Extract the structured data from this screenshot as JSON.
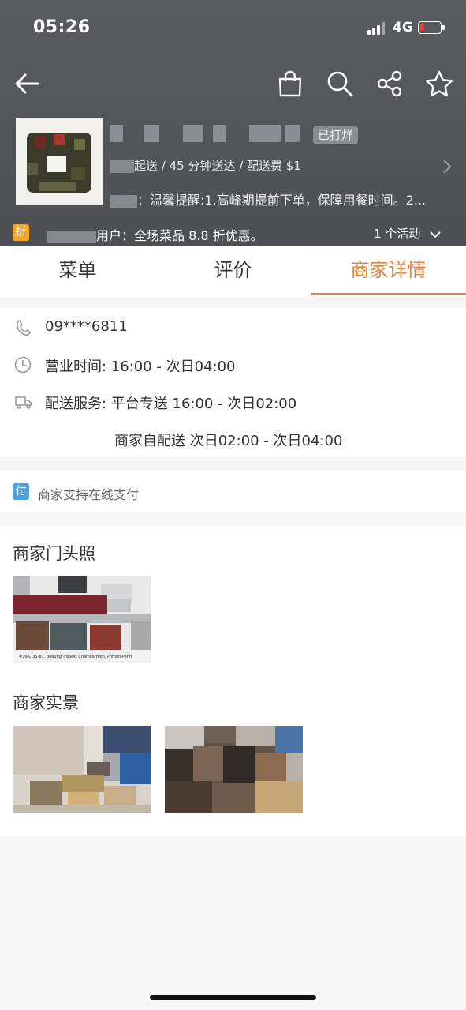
{
  "status_bar": {
    "time": "05:26",
    "network": "4G"
  },
  "shop": {
    "tag": "已打烊",
    "delivery_info": "起送 / 45 分钟送达 / 配送费 $1",
    "notice": "：温馨提醒:1.高峰期提前下单，保障用餐时间。2...",
    "promo": "用户：全场菜品 8.8 折优惠。",
    "discount_badge": "折",
    "activity_count": "1 个活动"
  },
  "nav": {
    "icons": [
      "back-arrow-icon",
      "shopping-bag-icon",
      "search-icon",
      "share-icon",
      "star-icon"
    ]
  },
  "tabs": [
    {
      "label": "菜单",
      "active": false
    },
    {
      "label": "评价",
      "active": false
    },
    {
      "label": "商家详情",
      "active": true
    }
  ],
  "details": {
    "phone": "09****6811",
    "hours": "营业时间: 16:00 - 次日04:00",
    "delivery_service": "配送服务: 平台专送 16:00 - 次日02:00",
    "merchant_delivery": "商家自配送 次日02:00 - 次日04:00"
  },
  "payment": {
    "badge": "付",
    "text": "商家支持在线支付"
  },
  "sections": {
    "storefront_title": "商家门头照",
    "interior_title": "商家实景",
    "storefront_caption": "#26A, 31-81, Boeung Trabek, Chamkarmon, Phnom Penh"
  },
  "colors": {
    "accent": "#e3823c",
    "header_bg": "#54565a",
    "pay_blue": "#4aa3df",
    "discount_orange": "#f5a623"
  }
}
